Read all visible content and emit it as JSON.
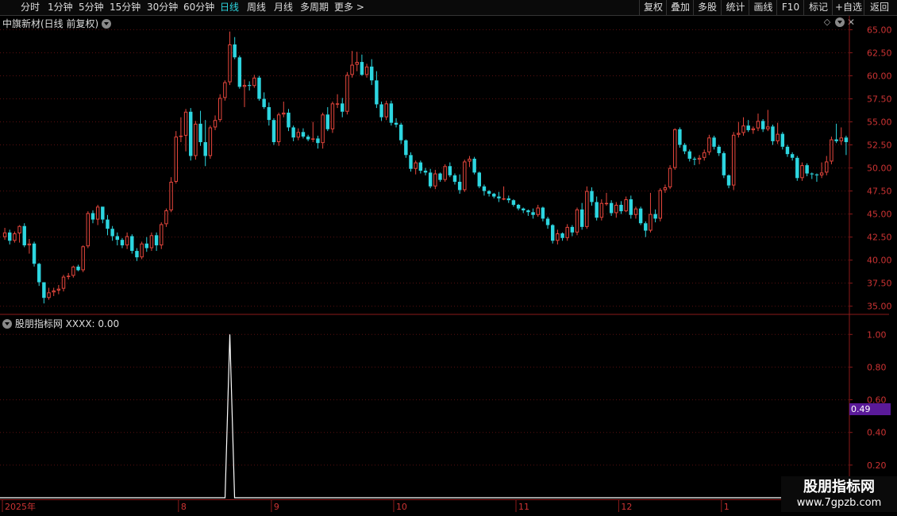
{
  "toolbar": {
    "timeframes": [
      {
        "label": "分时",
        "active": false
      },
      {
        "label": "1分钟",
        "active": false
      },
      {
        "label": "5分钟",
        "active": false
      },
      {
        "label": "15分钟",
        "active": false
      },
      {
        "label": "30分钟",
        "active": false
      },
      {
        "label": "60分钟",
        "active": false
      },
      {
        "label": "日线",
        "active": true
      },
      {
        "label": "周线",
        "active": false
      },
      {
        "label": "月线",
        "active": false
      },
      {
        "label": "多周期",
        "active": false
      },
      {
        "label": "更多 >",
        "active": false
      }
    ],
    "right_buttons": [
      "复权",
      "叠加",
      "多股",
      "统计",
      "画线",
      "F10",
      "标记",
      "+自选",
      "返回"
    ]
  },
  "main_chart": {
    "title": "中旗新材(日线 前复权)"
  },
  "indicator": {
    "title": "股朋指标网",
    "series_label": "XXXX: 0.00",
    "current_value": "0.49"
  },
  "watermark": {
    "line1": "股朋指标网",
    "line2": "www.7gpzb.com"
  },
  "colors": {
    "up": "#e8473d",
    "down": "#2dd6e0",
    "axis": "#8b1a1a",
    "active_tab": "#2dd6e0",
    "value_badge": "#5a1a99"
  },
  "chart_data": [
    {
      "type": "candlestick",
      "title": "中旗新材(日线 前复权)",
      "y_ticks": [
        "65.00",
        "62.50",
        "60.00",
        "57.50",
        "55.00",
        "52.50",
        "50.00",
        "47.50",
        "45.00",
        "42.50",
        "40.00",
        "37.50",
        "35.00"
      ],
      "ylim": [
        34.2,
        66.5
      ],
      "x_tick_labels": [
        "2025年",
        "8",
        "9",
        "10",
        "11",
        "12",
        "1"
      ],
      "candles": [
        [
          42.5,
          43.5,
          42.2,
          43.0
        ],
        [
          43.0,
          43.3,
          41.7,
          42.1
        ],
        [
          42.1,
          43.1,
          41.9,
          42.9
        ],
        [
          42.9,
          43.8,
          41.9,
          43.7
        ],
        [
          43.7,
          44.0,
          41.4,
          41.6
        ],
        [
          41.6,
          42.3,
          40.7,
          41.8
        ],
        [
          41.8,
          42.0,
          39.3,
          39.6
        ],
        [
          39.6,
          39.7,
          37.2,
          37.6
        ],
        [
          37.6,
          37.6,
          35.3,
          35.9
        ],
        [
          35.9,
          37.0,
          35.7,
          36.5
        ],
        [
          36.5,
          37.0,
          36.1,
          36.7
        ],
        [
          36.7,
          37.3,
          36.3,
          36.9
        ],
        [
          36.9,
          38.4,
          36.6,
          38.2
        ],
        [
          38.2,
          38.6,
          37.9,
          38.3
        ],
        [
          38.3,
          39.4,
          38.1,
          39.3
        ],
        [
          39.3,
          39.5,
          38.8,
          38.9
        ],
        [
          38.9,
          41.6,
          38.7,
          41.5
        ],
        [
          41.5,
          45.3,
          41.3,
          45.1
        ],
        [
          45.1,
          45.4,
          44.0,
          44.4
        ],
        [
          44.4,
          46.0,
          43.8,
          45.8
        ],
        [
          45.8,
          45.8,
          44.0,
          44.4
        ],
        [
          44.4,
          44.9,
          42.7,
          43.4
        ],
        [
          43.4,
          43.7,
          42.1,
          42.6
        ],
        [
          42.6,
          43.0,
          41.6,
          42.2
        ],
        [
          42.2,
          42.4,
          41.3,
          41.6
        ],
        [
          41.6,
          43.0,
          41.2,
          42.6
        ],
        [
          42.6,
          42.8,
          40.7,
          41.0
        ],
        [
          41.0,
          41.3,
          39.9,
          40.3
        ],
        [
          40.3,
          42.0,
          40.1,
          41.8
        ],
        [
          41.8,
          42.5,
          40.9,
          41.3
        ],
        [
          41.3,
          43.0,
          41.0,
          42.7
        ],
        [
          42.7,
          43.0,
          41.0,
          41.6
        ],
        [
          41.6,
          44.1,
          41.2,
          43.9
        ],
        [
          43.9,
          45.6,
          43.6,
          45.4
        ],
        [
          45.4,
          49.0,
          45.2,
          48.5
        ],
        [
          48.5,
          54.0,
          48.3,
          53.4
        ],
        [
          53.4,
          55.5,
          52.8,
          53.5
        ],
        [
          53.5,
          56.4,
          51.8,
          56.1
        ],
        [
          56.1,
          56.5,
          50.8,
          51.3
        ],
        [
          51.3,
          55.1,
          50.9,
          54.8
        ],
        [
          54.8,
          56.2,
          52.4,
          52.8
        ],
        [
          52.8,
          55.2,
          50.2,
          51.3
        ],
        [
          51.3,
          54.6,
          51.0,
          54.4
        ],
        [
          54.4,
          55.7,
          54.1,
          55.2
        ],
        [
          55.2,
          58.0,
          55.0,
          57.6
        ],
        [
          57.6,
          59.5,
          57.3,
          59.3
        ],
        [
          59.3,
          64.8,
          59.0,
          63.4
        ],
        [
          63.4,
          64.2,
          61.8,
          62.0
        ],
        [
          62.0,
          62.2,
          58.6,
          58.8
        ],
        [
          58.8,
          59.6,
          56.6,
          59.0
        ],
        [
          59.0,
          59.4,
          58.4,
          58.9
        ],
        [
          58.9,
          60.1,
          58.7,
          59.8
        ],
        [
          59.8,
          60.0,
          57.3,
          57.5
        ],
        [
          57.5,
          58.2,
          56.4,
          56.6
        ],
        [
          56.6,
          57.1,
          54.6,
          55.2
        ],
        [
          55.2,
          55.4,
          52.5,
          52.8
        ],
        [
          52.8,
          56.0,
          52.4,
          55.8
        ],
        [
          55.8,
          57.2,
          55.5,
          56.0
        ],
        [
          56.0,
          56.4,
          54.0,
          54.4
        ],
        [
          54.4,
          54.6,
          52.9,
          53.3
        ],
        [
          53.3,
          54.3,
          53.0,
          53.9
        ],
        [
          53.9,
          54.3,
          53.2,
          53.4
        ],
        [
          53.4,
          53.6,
          52.9,
          53.1
        ],
        [
          53.1,
          55.0,
          52.8,
          53.2
        ],
        [
          53.2,
          53.5,
          52.1,
          52.7
        ],
        [
          52.7,
          56.0,
          52.1,
          55.8
        ],
        [
          55.8,
          56.6,
          54.0,
          54.2
        ],
        [
          54.2,
          57.2,
          53.8,
          57.0
        ],
        [
          57.0,
          58.0,
          56.5,
          57.0
        ],
        [
          57.0,
          57.6,
          55.5,
          56.1
        ],
        [
          56.1,
          60.4,
          55.8,
          60.1
        ],
        [
          60.1,
          62.7,
          59.8,
          61.2
        ],
        [
          61.2,
          62.6,
          60.5,
          61.5
        ],
        [
          61.5,
          62.3,
          60.0,
          60.1
        ],
        [
          60.1,
          61.3,
          59.8,
          61.0
        ],
        [
          61.0,
          61.8,
          59.0,
          59.5
        ],
        [
          59.5,
          60.5,
          56.5,
          56.9
        ],
        [
          56.9,
          57.2,
          55.1,
          55.5
        ],
        [
          55.5,
          57.3,
          55.2,
          57.0
        ],
        [
          57.0,
          57.3,
          54.6,
          54.9
        ],
        [
          54.9,
          55.4,
          54.4,
          54.7
        ],
        [
          54.7,
          54.9,
          52.6,
          53.0
        ],
        [
          53.0,
          53.1,
          51.1,
          51.4
        ],
        [
          51.4,
          51.7,
          49.6,
          49.9
        ],
        [
          49.9,
          50.8,
          49.3,
          50.6
        ],
        [
          50.6,
          50.8,
          49.4,
          49.7
        ],
        [
          49.7,
          50.0,
          49.2,
          49.5
        ],
        [
          49.5,
          49.9,
          47.8,
          48.0
        ],
        [
          48.0,
          49.8,
          47.7,
          49.4
        ],
        [
          49.4,
          49.5,
          48.5,
          48.7
        ],
        [
          48.7,
          50.4,
          48.5,
          50.2
        ],
        [
          50.2,
          50.6,
          49.0,
          49.2
        ],
        [
          49.2,
          49.4,
          48.2,
          48.5
        ],
        [
          48.5,
          49.3,
          47.2,
          47.6
        ],
        [
          47.6,
          50.9,
          47.4,
          50.7
        ],
        [
          50.7,
          51.3,
          50.1,
          51.0
        ],
        [
          51.0,
          51.2,
          49.3,
          49.5
        ],
        [
          49.5,
          49.6,
          47.8,
          48.0
        ],
        [
          48.0,
          48.2,
          47.0,
          47.5
        ],
        [
          47.5,
          47.6,
          46.9,
          47.2
        ],
        [
          47.2,
          47.3,
          46.7,
          46.9
        ],
        [
          46.9,
          47.4,
          46.3,
          46.7
        ],
        [
          46.7,
          48.0,
          46.5,
          46.7
        ],
        [
          46.7,
          47.0,
          46.2,
          46.5
        ],
        [
          46.5,
          46.6,
          45.8,
          46.0
        ],
        [
          46.0,
          46.1,
          45.4,
          45.6
        ],
        [
          45.6,
          45.7,
          45.1,
          45.4
        ],
        [
          45.4,
          45.5,
          44.8,
          45.2
        ],
        [
          45.2,
          45.6,
          44.5,
          44.9
        ],
        [
          44.9,
          46.0,
          44.7,
          45.7
        ],
        [
          45.7,
          45.8,
          44.2,
          44.5
        ],
        [
          44.5,
          44.7,
          43.4,
          43.8
        ],
        [
          43.8,
          43.9,
          41.8,
          42.1
        ],
        [
          42.1,
          43.3,
          41.7,
          42.9
        ],
        [
          42.9,
          43.0,
          42.1,
          42.4
        ],
        [
          42.4,
          43.9,
          42.1,
          43.6
        ],
        [
          43.6,
          43.8,
          42.6,
          43.0
        ],
        [
          43.0,
          45.7,
          42.7,
          45.5
        ],
        [
          45.5,
          46.2,
          43.3,
          43.6
        ],
        [
          43.6,
          48.0,
          43.4,
          47.5
        ],
        [
          47.5,
          47.9,
          45.9,
          46.3
        ],
        [
          46.3,
          46.9,
          44.3,
          44.6
        ],
        [
          44.6,
          46.6,
          44.3,
          46.2
        ],
        [
          46.2,
          47.3,
          45.9,
          46.2
        ],
        [
          46.2,
          46.5,
          44.8,
          45.1
        ],
        [
          45.1,
          46.3,
          44.6,
          46.0
        ],
        [
          46.0,
          46.4,
          45.0,
          45.3
        ],
        [
          45.3,
          46.9,
          45.2,
          46.6
        ],
        [
          46.6,
          47.0,
          44.5,
          44.9
        ],
        [
          44.9,
          45.8,
          44.5,
          45.6
        ],
        [
          45.6,
          45.8,
          43.8,
          44.0
        ],
        [
          44.0,
          44.2,
          42.5,
          43.2
        ],
        [
          43.2,
          47.3,
          43.0,
          45.0
        ],
        [
          45.0,
          45.5,
          44.1,
          44.5
        ],
        [
          44.5,
          47.8,
          44.2,
          47.6
        ],
        [
          47.6,
          48.2,
          47.3,
          47.9
        ],
        [
          47.9,
          50.3,
          47.7,
          50.0
        ],
        [
          50.0,
          54.3,
          49.8,
          54.2
        ],
        [
          54.2,
          54.4,
          52.2,
          52.5
        ],
        [
          52.5,
          52.7,
          51.5,
          51.8
        ],
        [
          51.8,
          52.0,
          50.7,
          51.0
        ],
        [
          51.0,
          51.2,
          50.3,
          50.9
        ],
        [
          50.9,
          51.4,
          50.4,
          51.1
        ],
        [
          51.1,
          52.0,
          50.8,
          51.7
        ],
        [
          51.7,
          53.6,
          51.4,
          53.3
        ],
        [
          53.3,
          53.5,
          52.0,
          52.3
        ],
        [
          52.3,
          52.5,
          51.3,
          51.6
        ],
        [
          51.6,
          51.8,
          48.9,
          49.2
        ],
        [
          49.2,
          49.3,
          47.8,
          48.1
        ],
        [
          48.1,
          53.9,
          47.6,
          53.6
        ],
        [
          53.6,
          55.0,
          53.3,
          53.8
        ],
        [
          53.8,
          55.5,
          53.5,
          54.6
        ],
        [
          54.6,
          55.2,
          53.9,
          54.1
        ],
        [
          54.1,
          54.5,
          53.7,
          54.3
        ],
        [
          54.3,
          55.9,
          54.0,
          55.1
        ],
        [
          55.1,
          55.3,
          53.9,
          54.2
        ],
        [
          54.2,
          56.3,
          54.0,
          54.5
        ],
        [
          54.5,
          54.7,
          52.5,
          52.9
        ],
        [
          52.9,
          54.9,
          52.6,
          53.7
        ],
        [
          53.7,
          53.9,
          52.0,
          52.3
        ],
        [
          52.3,
          52.5,
          51.2,
          51.5
        ],
        [
          51.5,
          51.7,
          50.8,
          51.1
        ],
        [
          51.1,
          51.3,
          48.6,
          48.9
        ],
        [
          48.9,
          50.6,
          48.6,
          50.3
        ],
        [
          50.3,
          50.5,
          49.1,
          49.4
        ],
        [
          49.4,
          49.5,
          48.8,
          49.3
        ],
        [
          49.3,
          49.4,
          48.5,
          49.2
        ],
        [
          49.2,
          50.6,
          48.9,
          49.5
        ],
        [
          49.5,
          51.3,
          49.2,
          50.7
        ],
        [
          50.7,
          53.4,
          50.4,
          53.1
        ],
        [
          53.1,
          54.8,
          52.7,
          52.9
        ],
        [
          52.9,
          54.4,
          52.5,
          53.3
        ],
        [
          53.3,
          53.5,
          51.4,
          52.8
        ]
      ]
    },
    {
      "type": "line",
      "title": "股朋指标网",
      "series": [
        {
          "name": "XXXX",
          "last_value": 0.0
        }
      ],
      "y_ticks": [
        "1.00",
        "0.80",
        "0.60",
        "0.40",
        "0.20"
      ],
      "ylim": [
        0,
        1.05
      ],
      "spike_index": 46,
      "spike_value": 1.0,
      "baseline_value": 0.0
    }
  ]
}
